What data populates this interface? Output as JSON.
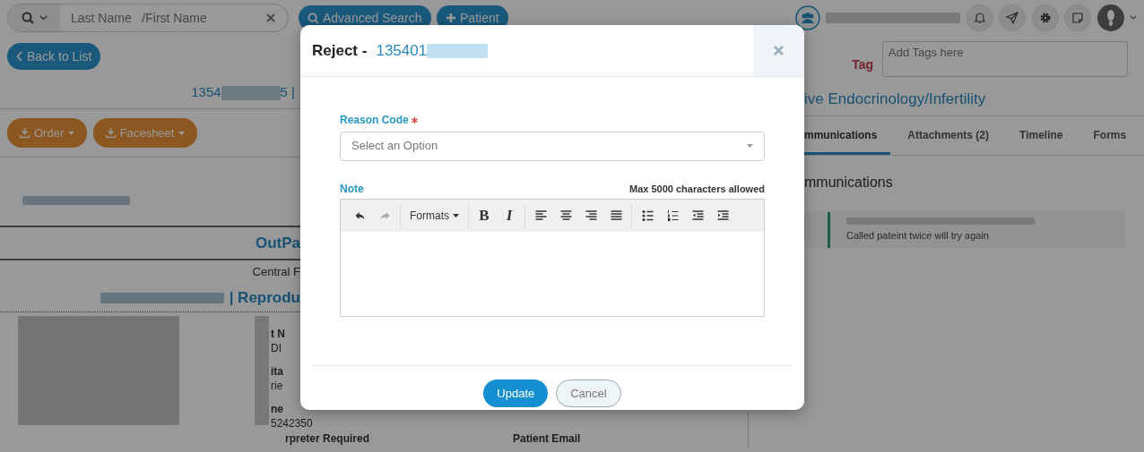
{
  "top_bar": {
    "search": {
      "placeholder": "Last Name   /First Name"
    },
    "buttons": [
      {
        "label": "Advanced Search",
        "kind": "search"
      },
      {
        "label": "Patient",
        "kind": "add"
      }
    ]
  },
  "back_button": "Back to List",
  "patient_id": {
    "prefix": "1354",
    "suffix": "5 |"
  },
  "action_buttons": [
    "Order",
    "Facesheet"
  ],
  "report": {
    "title": "OutPa",
    "subtitle": "Central F",
    "department": "| Reprodu"
  },
  "details": [
    {
      "text": "t N",
      "kind": "label"
    },
    {
      "text": "DI",
      "kind": "value"
    },
    {
      "text": "ita",
      "kind": "label"
    },
    {
      "text": "rie",
      "kind": "value"
    },
    {
      "text": "ne",
      "kind": "label"
    },
    {
      "text": "5242350",
      "kind": "value"
    }
  ],
  "bottom_labels": [
    "rpreter Required",
    "Patient Email"
  ],
  "tag": {
    "label": "Tag",
    "placeholder": "Add Tags here"
  },
  "specialty": "ive Endocrinology/Infertility",
  "tabs": [
    {
      "label": "mmunications",
      "selected": true
    },
    {
      "label": "Attachments (2)",
      "selected": false
    },
    {
      "label": "Timeline",
      "selected": false
    },
    {
      "label": "Forms",
      "selected": false
    }
  ],
  "communications": {
    "heading": "mmunications",
    "items": [
      {
        "text": "Called pateint twice will try again"
      }
    ]
  },
  "modal": {
    "title": "Reject -",
    "record_id": "135401",
    "reason": {
      "label": "Reason Code",
      "required": true,
      "placeholder": "Select an Option"
    },
    "note": {
      "label": "Note",
      "limit": "Max 5000 characters allowed",
      "toolbar": [
        [
          {
            "kind": "undo",
            "disabled": false
          },
          {
            "kind": "redo",
            "disabled": true
          }
        ],
        [
          {
            "kind": "dropdown",
            "label": "Formats"
          }
        ],
        [
          {
            "kind": "bold",
            "label": "B"
          },
          {
            "kind": "italic",
            "label": "I"
          }
        ],
        [
          {
            "kind": "align-left"
          },
          {
            "kind": "align-center"
          },
          {
            "kind": "align-right"
          },
          {
            "kind": "justify"
          }
        ],
        [
          {
            "kind": "bullet-list"
          },
          {
            "kind": "numbered-list"
          },
          {
            "kind": "outdent"
          },
          {
            "kind": "indent"
          }
        ]
      ]
    },
    "buttons": [
      {
        "label": "Update",
        "kind": "primary"
      },
      {
        "label": "Cancel",
        "kind": "secondary"
      }
    ]
  }
}
